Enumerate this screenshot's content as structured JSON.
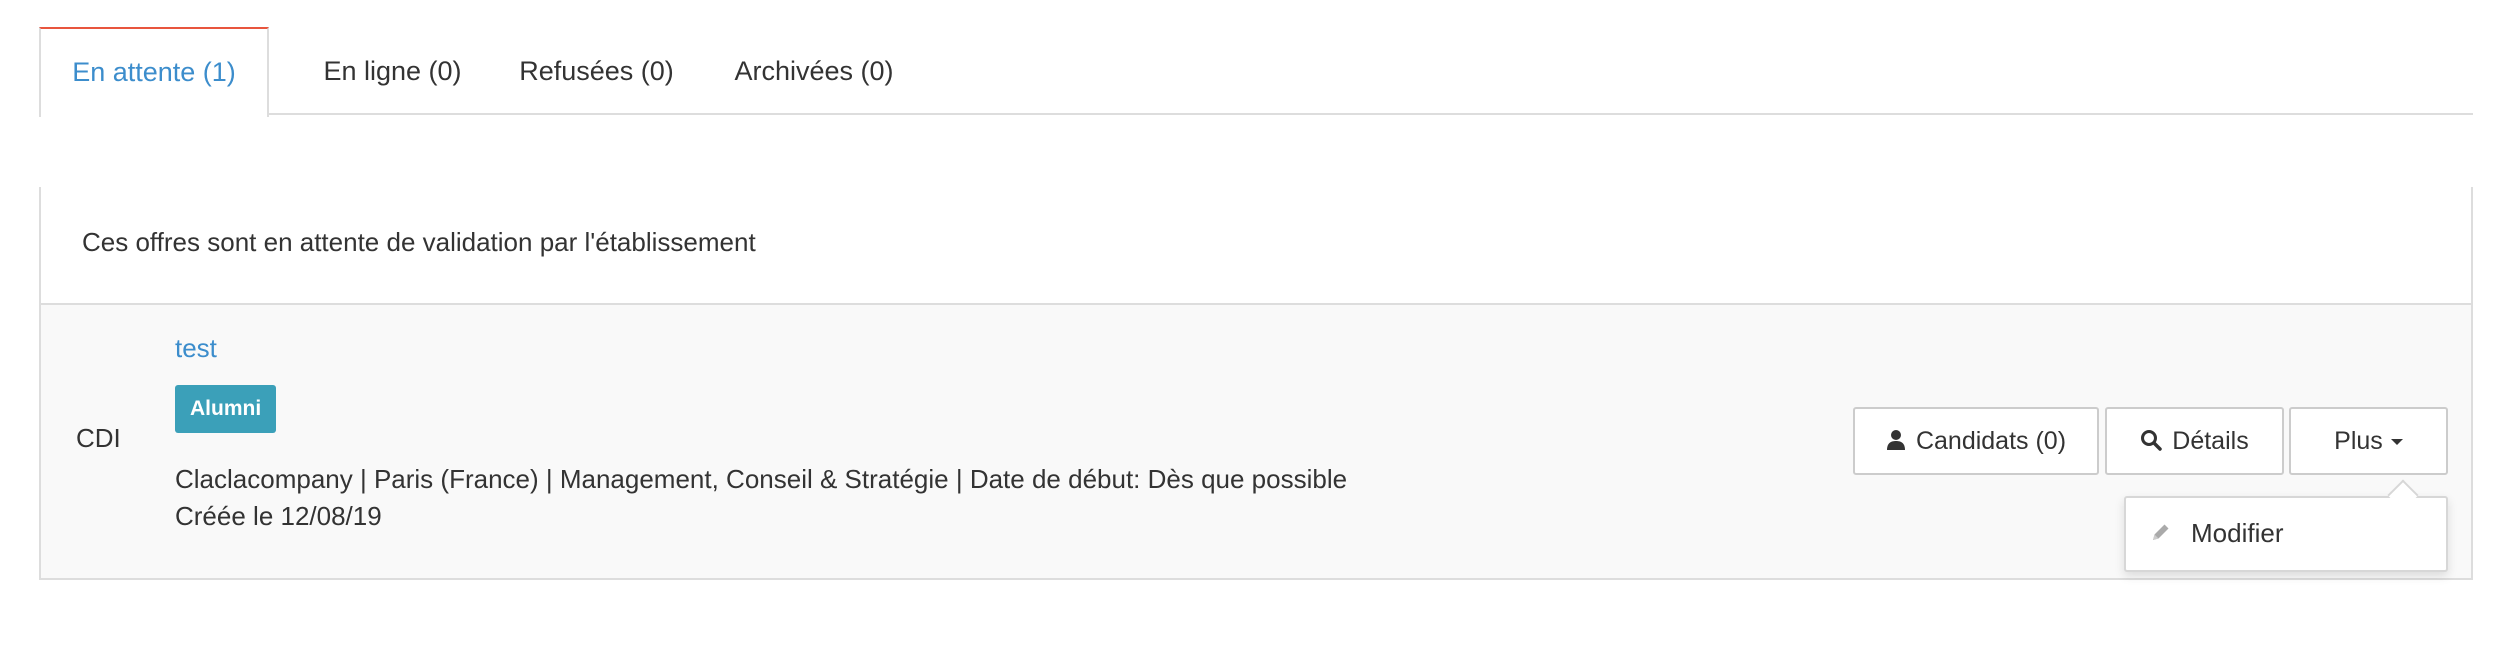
{
  "tabs": [
    {
      "label": "En attente (1)",
      "active": true
    },
    {
      "label": "En ligne (0)",
      "active": false
    },
    {
      "label": "Refusées (0)",
      "active": false
    },
    {
      "label": "Archivées (0)",
      "active": false
    }
  ],
  "panel": {
    "heading": "Ces offres sont en attente de validation par l'établissement"
  },
  "offer": {
    "contract_type": "CDI",
    "title": "test",
    "badge": "Alumni",
    "details": "Claclacompany | Paris (France) | Management, Conseil & Stratégie | Date de début: Dès que possible",
    "created": "Créée le 12/08/19"
  },
  "actions": {
    "candidates_label": "Candidats (0)",
    "details_label": "Détails",
    "more_label": "Plus"
  },
  "dropdown": {
    "items": [
      {
        "label": "Modifier",
        "icon": "pencil-icon"
      }
    ]
  },
  "colors": {
    "accent": "#3c8dcc",
    "active_tab_top": "#e8553e",
    "badge_bg": "#3ba0b9"
  }
}
